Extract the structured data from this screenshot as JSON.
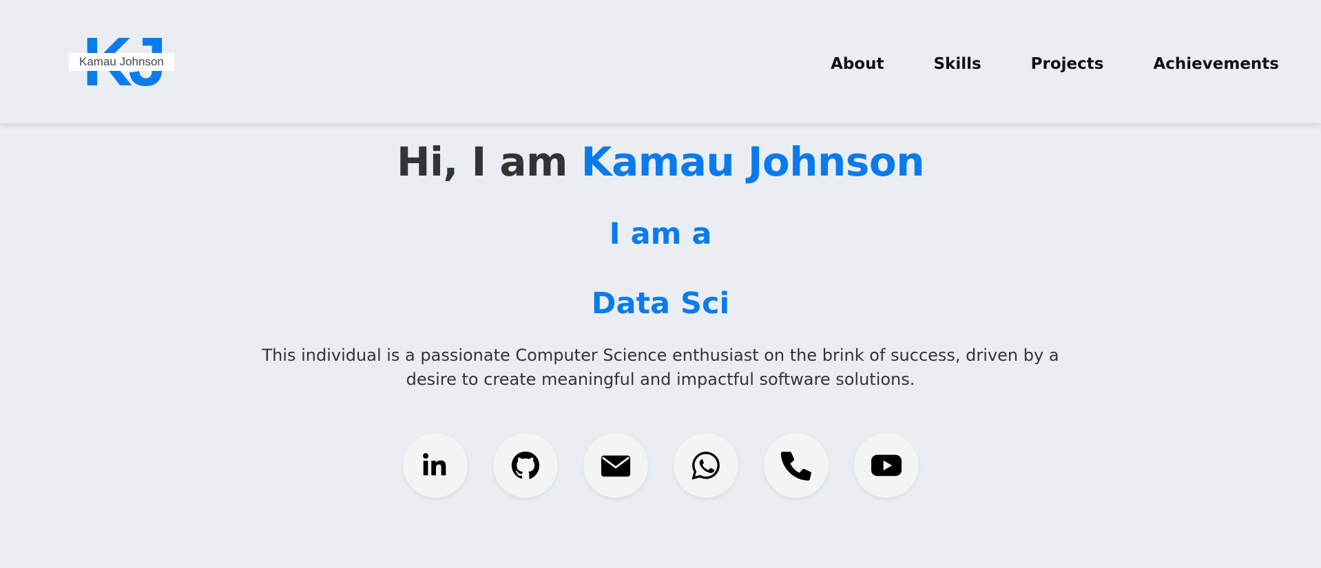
{
  "header": {
    "logo_text": "KJ",
    "logo_tooltip": "Kamau Johnson",
    "nav": [
      {
        "label": "About"
      },
      {
        "label": "Skills"
      },
      {
        "label": "Projects"
      },
      {
        "label": "Achievements"
      }
    ]
  },
  "hero": {
    "greeting_prefix": "Hi, I am ",
    "name": "Kamau Johnson",
    "iam": "I am a",
    "role": "Data Sci",
    "bio": "This individual is a passionate Computer Science enthusiast on the brink of success, driven by a desire to create meaningful and impactful software solutions."
  },
  "socials": [
    {
      "icon": "linkedin-icon"
    },
    {
      "icon": "github-icon"
    },
    {
      "icon": "email-icon"
    },
    {
      "icon": "whatsapp-icon"
    },
    {
      "icon": "phone-icon"
    },
    {
      "icon": "youtube-icon"
    }
  ],
  "colors": {
    "accent": "#0b7bec",
    "background": "#eaeef2",
    "text": "#333333"
  }
}
